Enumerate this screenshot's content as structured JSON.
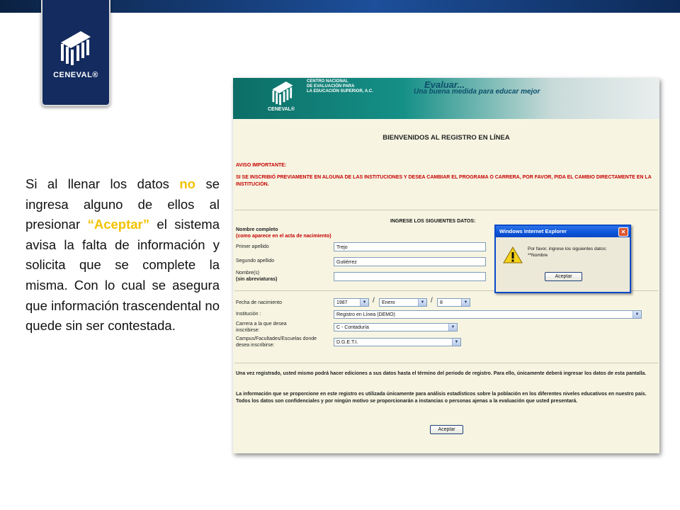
{
  "slide": {
    "brand": "CENEVAL®",
    "description": {
      "part1": "Si al llenar los datos ",
      "highlight1": "no",
      "part2": " se ingresa alguno de ellos al presionar ",
      "highlight2": "“Aceptar”",
      "part3": " el sistema avisa la falta de información y solicita que se complete la misma. Con lo cual se asegura que información trascendental no quede sin ser contestada."
    }
  },
  "screenshot": {
    "header": {
      "institution_line1": "CENTRO NACIONAL",
      "institution_line2": "DE EVALUACIÓN PARA",
      "institution_line3": "LA EDUCACIÓN SUPERIOR, A.C.",
      "brand": "CENEVAL®",
      "slogan_line1": "Evaluar...",
      "slogan_line2": "Una buena medida para educar mejor"
    },
    "welcome": "BIENVENIDOS AL REGISTRO EN LÍNEA",
    "notice_title": "AVISO IMPORTANTE:",
    "notice_text": "SI SE INSCRIBIÓ PREVIAMENTE EN ALGUNA DE LAS INSTITUCIONES Y DESEA CAMBIAR EL PROGRAMA O CARRERA, POR FAVOR, PIDA EL CAMBIO DIRECTAMENTE EN LA INSTITUCIÓN.",
    "form_title": "INGRESE LOS SIGUIENTES DATOS:",
    "form": {
      "full_name_label": "Nombre completo",
      "full_name_hint": "(como aparece en el acta de nacimiento)",
      "first_surname_label": "Primer apellido",
      "first_surname_value": "Trejo",
      "second_surname_label": "Segundo apellido",
      "second_surname_value": "Gutiérrez",
      "names_label": "Nombre(s)",
      "names_hint": "(sin abreviaturas)",
      "names_value": "",
      "birthdate_label": "Fecha de nacimiento",
      "birth_year": "1987",
      "birth_month": "Enero",
      "birth_day": "8",
      "date_separator": "/",
      "institution_label": "Institución :",
      "institution_value": "Registro en Línea (DEMO)",
      "career_label": "Carrera a la que desea inscribirse:",
      "career_value": "C - Contaduría",
      "campus_label": "Campus/Facultades/Escuelas donde desea inscribirse:",
      "campus_value": "D.G.E.T.I."
    },
    "footer_text1": "Una vez registrado, usted mismo podrá hacer ediciones a sus datos hasta el término del periodo de registro. Para ello, únicamente deberá ingresar los datos de esta pantalla.",
    "footer_text2": "La información que se proporcione en este registro es utilizada únicamente para análisis estadísticos sobre la población en los diferentes niveles educativos en nuestro país. Todos los datos son confidenciales y por ningún motivo se proporcionarán a instancias o personas ajenas a la evaluación que usted presentará.",
    "submit_label": "Aceptar",
    "dialog": {
      "title": "Windows Internet Explorer",
      "close": "✕",
      "message_line1": "Por favor, ingrese los siguientes datos:",
      "message_line2": "**Nombre",
      "ok_label": "Aceptar"
    }
  },
  "colors": {
    "top_bar": "#1d4f9a",
    "logo_tab": "#132b5e",
    "highlight": "#f2c200",
    "form_bg": "#f7f5e2",
    "notice_red": "#c60000",
    "header_teal": "#159087"
  },
  "icons": [
    "ceneval-logo",
    "warning-icon",
    "dropdown-arrow-icon",
    "close-icon"
  ]
}
